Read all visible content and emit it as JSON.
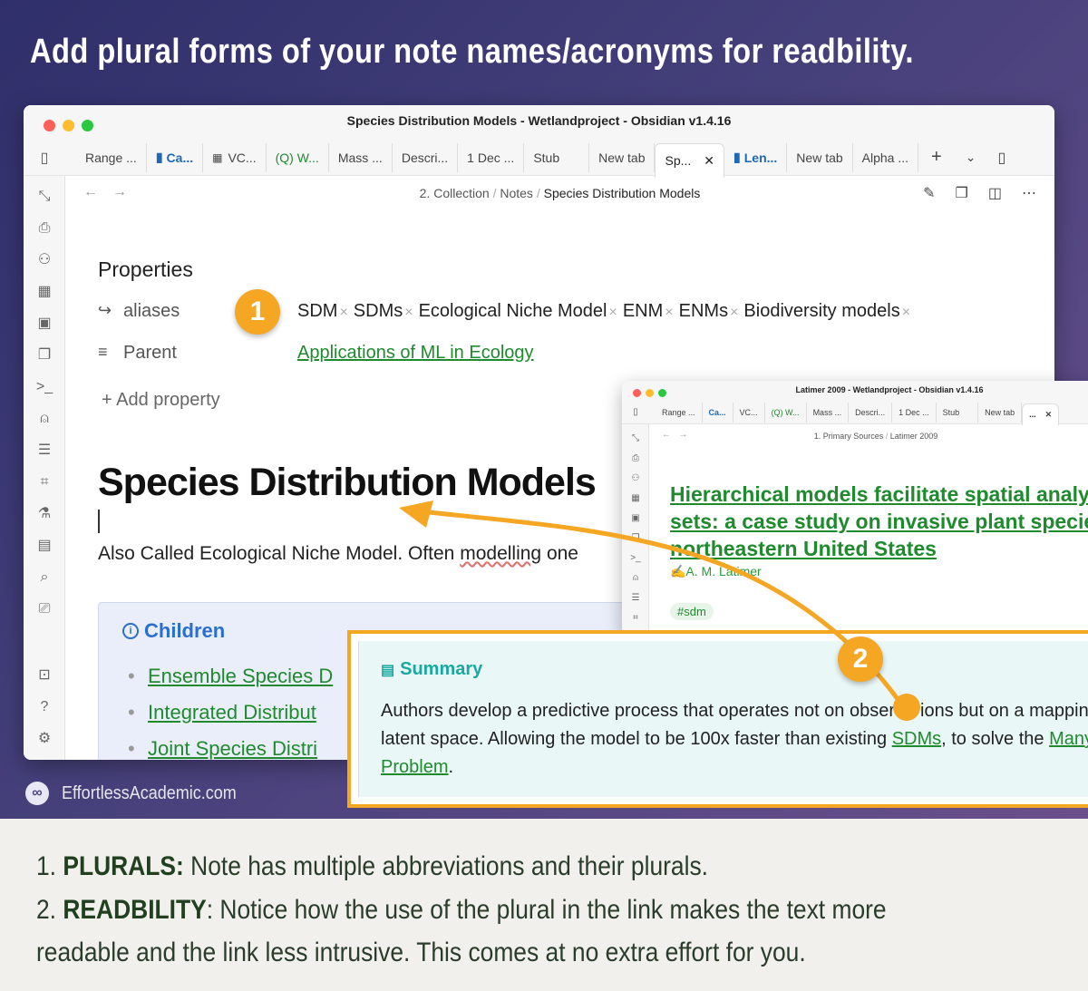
{
  "headline": "Add plural forms of your note names/acronyms for readbility.",
  "brand": {
    "text": "EffortlessAcademic.com"
  },
  "colors": {
    "accent": "#f5a623",
    "link": "#1f8a2e",
    "callout": "#2a6fd0",
    "summary": "#1aa9a0",
    "background_top": "#3a3a78"
  },
  "main_window": {
    "title": "Species Distribution Models - Wetlandproject - Obsidian v1.4.16",
    "tabs": [
      "Range ...",
      "Ca...",
      "VC...",
      "(Q) W...",
      "Mass ...",
      "Descri...",
      "1 Dec ...",
      "Stub",
      "New tab",
      "Sp...",
      "Len...",
      "New tab",
      "Alpha ..."
    ],
    "breadcrumb": [
      "2. Collection",
      "Notes",
      "Species Distribution Models"
    ],
    "properties": {
      "heading": "Properties",
      "aliases_label": "aliases",
      "aliases": [
        "SDM",
        "SDMs",
        "Ecological Niche Model",
        "ENM",
        "ENMs",
        "Biodiversity models"
      ],
      "parent_label": "Parent",
      "parent_value": "Applications of ML in Ecology",
      "add_property": "+ Add property"
    },
    "note_title": "Species Distribution Models",
    "body_text": "Also Called Ecological Niche Model. Often",
    "body_underlined": "modelling",
    "body_tail": "one",
    "callout": {
      "title": "Children",
      "items": [
        "Ensemble Species D",
        "Integrated Distribut",
        "Joint Species Distri"
      ]
    }
  },
  "second_window": {
    "title": "Latimer 2009 - Wetlandproject - Obsidian v1.4.16",
    "tabs": [
      "Range ...",
      "Ca...",
      "VC...",
      "(Q) W...",
      "Mass ...",
      "Descri...",
      "1 Dec ...",
      "Stub",
      "New tab",
      "..."
    ],
    "breadcrumb": [
      "1. Primary Sources",
      "Latimer 2009"
    ],
    "note_title_lines": [
      "Hierarchical models facilitate spatial analys",
      "sets: a case study on invasive plant species",
      "northeastern United States"
    ],
    "author": "✍A. M. Latimer",
    "tag": "#sdm"
  },
  "summary": {
    "title": "Summary",
    "line1": "Authors develop a predictive process that operates not on obser",
    "line1_tail": "ions but on a mapping",
    "line2_pre": "latent space. Allowing the model to be 100x faster than existing ",
    "line2_link": "SDMs",
    "line2_post": ", to solve the ",
    "line2_link2": "Many",
    "line3_link": "Problem",
    "line3_post": "."
  },
  "badges": [
    "1",
    "2"
  ],
  "caption": {
    "item1_num": "1. ",
    "item1_bold": "PLURALS:",
    "item1_text": " Note has multiple abbreviations and their plurals.",
    "item2_num": "2. ",
    "item2_bold": "READBILITY",
    "item2_text": ": Notice how the use of the plural in the link makes the text more readable and the link less intrusive. This comes at no extra effort for you."
  }
}
